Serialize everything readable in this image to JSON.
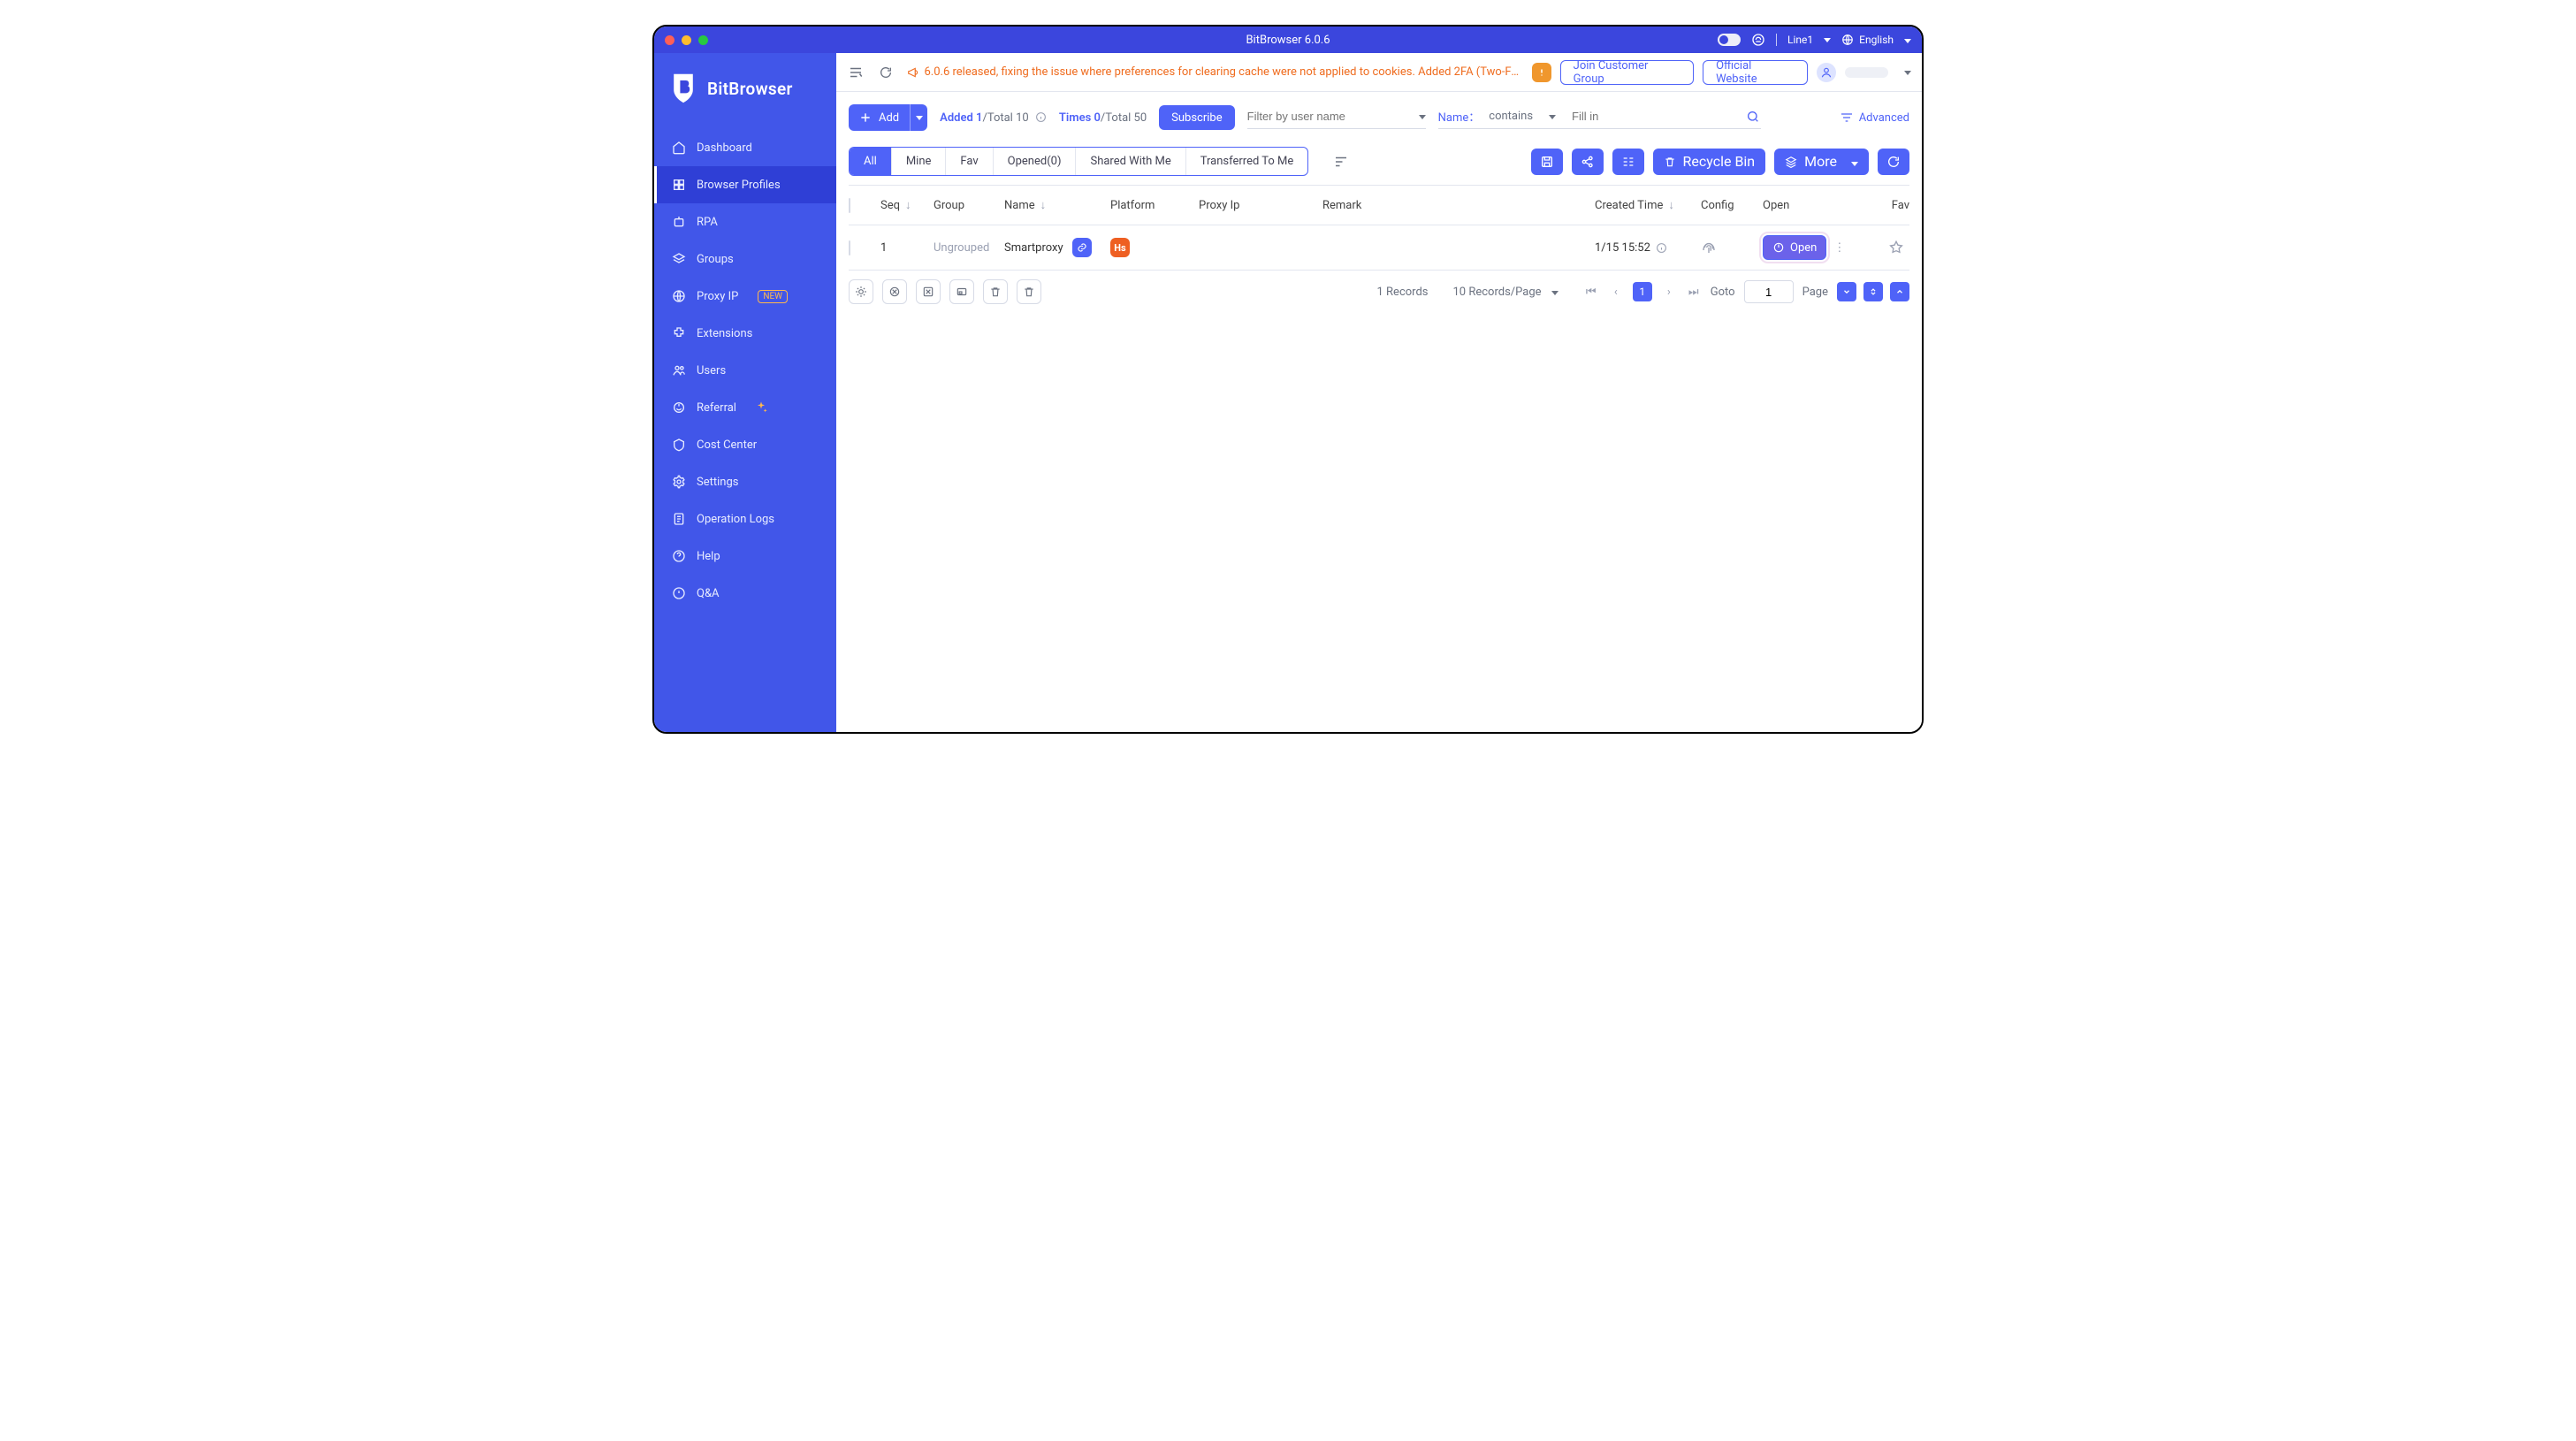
{
  "titlebar": {
    "title": "BitBrowser 6.0.6",
    "line_label": "Line1",
    "language_label": "English"
  },
  "sidebar": {
    "brand": "BitBrowser",
    "items": [
      {
        "key": "dashboard",
        "label": "Dashboard"
      },
      {
        "key": "browser-profiles",
        "label": "Browser Profiles",
        "active": true
      },
      {
        "key": "rpa",
        "label": "RPA"
      },
      {
        "key": "groups",
        "label": "Groups"
      },
      {
        "key": "proxy-ip",
        "label": "Proxy IP",
        "badge": "NEW"
      },
      {
        "key": "extensions",
        "label": "Extensions"
      },
      {
        "key": "users",
        "label": "Users"
      },
      {
        "key": "referral",
        "label": "Referral",
        "sparkle": true
      },
      {
        "key": "cost-center",
        "label": "Cost Center"
      },
      {
        "key": "settings",
        "label": "Settings"
      },
      {
        "key": "operation-logs",
        "label": "Operation Logs"
      },
      {
        "key": "help",
        "label": "Help"
      },
      {
        "key": "qa",
        "label": "Q&A"
      }
    ]
  },
  "topbar": {
    "announcement": "6.0.6 released, fixing the issue where preferences for clearing cache were not applied to cookies. Added 2FA (Two-Fa…",
    "join_group": "Join Customer Group",
    "official_website": "Official Website"
  },
  "filters": {
    "add_label": "Add",
    "added_label": "Added 1",
    "added_total": "/Total 10",
    "times_label": "Times 0",
    "times_total": "/Total 50",
    "subscribe_label": "Subscribe",
    "filter_placeholder": "Filter by user name",
    "name_label": "Name：",
    "condition": "contains",
    "value_placeholder": "Fill in",
    "advanced_label": "Advanced"
  },
  "tabs": [
    "All",
    "Mine",
    "Fav",
    "Opened(0)",
    "Shared With Me",
    "Transferred To Me"
  ],
  "toolbar_right": {
    "recycle_label": "Recycle Bin",
    "more_label": "More"
  },
  "table": {
    "headers": {
      "seq": "Seq",
      "group": "Group",
      "name": "Name",
      "platform": "Platform",
      "proxy": "Proxy Ip",
      "remark": "Remark",
      "created": "Created Time",
      "config": "Config",
      "open": "Open",
      "fav": "Fav"
    },
    "rows": [
      {
        "seq": "1",
        "group": "Ungrouped",
        "name": "Smartproxy",
        "platform_badge": "Hs",
        "created": "1/15 15:52",
        "open_label": "Open"
      }
    ]
  },
  "pager": {
    "records_label": "1 Records",
    "per_page_label": "10 Records/Page",
    "current_page": "1",
    "goto_label": "Goto",
    "goto_value": "1",
    "page_label": "Page"
  }
}
